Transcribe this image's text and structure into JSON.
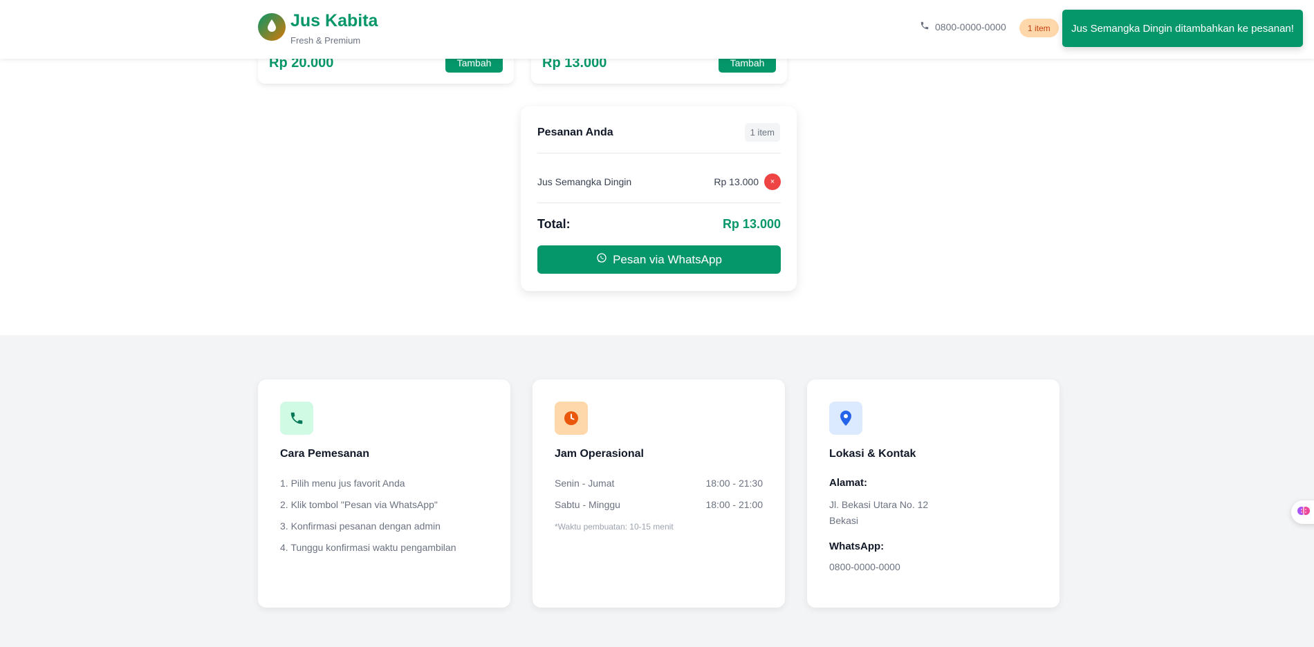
{
  "header": {
    "brand_title": "Jus Kabita",
    "brand_subtitle": "Fresh & Premium",
    "phone": "0800-0000-0000",
    "cart_badge": "1 item"
  },
  "toast": {
    "message": "Jus Semangka Dingin ditambahkan ke pesanan!"
  },
  "products": [
    {
      "price": "Rp 20.000",
      "button_label": "Tambah"
    },
    {
      "price": "Rp 13.000",
      "button_label": "Tambah"
    }
  ],
  "order": {
    "title": "Pesanan Anda",
    "count": "1 item",
    "items": [
      {
        "name": "Jus Semangka Dingin",
        "price": "Rp 13.000",
        "remove_icon": "×"
      }
    ],
    "total_label": "Total:",
    "total_value": "Rp 13.000",
    "whatsapp_button": "Pesan via WhatsApp"
  },
  "info": {
    "how_to_order": {
      "title": "Cara Pemesanan",
      "steps": [
        "1. Pilih menu jus favorit Anda",
        "2. Klik tombol \"Pesan via WhatsApp\"",
        "3. Konfirmasi pesanan dengan admin",
        "4. Tunggu konfirmasi waktu pengambilan"
      ]
    },
    "hours": {
      "title": "Jam Operasional",
      "rows": [
        {
          "days": "Senin - Jumat",
          "time": "18:00 - 21:30"
        },
        {
          "days": "Sabtu - Minggu",
          "time": "18:00 - 21:00"
        }
      ],
      "note": "*Waktu pembuatan: 10-15 menit"
    },
    "location": {
      "title": "Lokasi & Kontak",
      "address_label": "Alamat:",
      "address_line1": "Jl. Bekasi Utara No. 12",
      "address_line2": "Bekasi",
      "whatsapp_label": "WhatsApp:",
      "whatsapp_number": "0800-0000-0000"
    }
  },
  "colors": {
    "primary": "#059669",
    "accent_orange": "#ea580c",
    "accent_blue": "#2563eb",
    "danger": "#ef4444"
  },
  "icons": {
    "logo": "droplet-icon",
    "header_phone": "phone-icon",
    "whatsapp": "whatsapp-icon",
    "how_to_order": "phone-icon",
    "hours": "clock-icon",
    "location": "map-pin-icon",
    "side_widget": "brain-icon"
  }
}
